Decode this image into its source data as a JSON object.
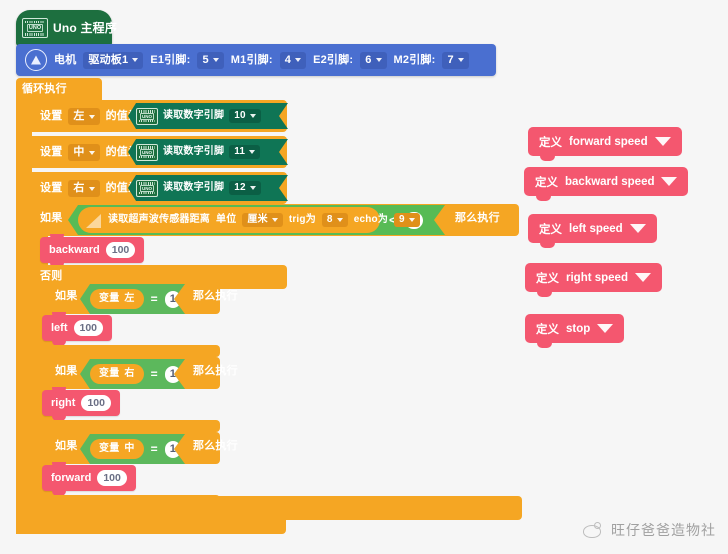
{
  "app": {
    "hat_label": "Uno 主程序",
    "uno_icon_text": "UNO"
  },
  "motor_block": {
    "title": "电机",
    "board_label": "驱动板1",
    "e1_label": "E1引脚:",
    "e1_value": "5",
    "m1_label": "M1引脚:",
    "m1_value": "4",
    "e2_label": "E2引脚:",
    "e2_value": "6",
    "m2_label": "M2引脚:",
    "m2_value": "7"
  },
  "loop": {
    "label": "循环执行"
  },
  "set_rows": [
    {
      "set": "设置",
      "var": "左",
      "of": "的值为",
      "read": "读取数字引脚",
      "pin": "10"
    },
    {
      "set": "设置",
      "var": "中",
      "of": "的值为",
      "read": "读取数字引脚",
      "pin": "11"
    },
    {
      "set": "设置",
      "var": "右",
      "of": "的值为",
      "read": "读取数字引脚",
      "pin": "12"
    }
  ],
  "outer_if": {
    "if_label": "如果",
    "then_label": "那么执行",
    "else_label": "否则",
    "sensor_text": "读取超声波传感器距离",
    "unit_label": "单位",
    "unit_value": "厘米",
    "trig_label": "trig为",
    "trig_value": "8",
    "echo_label": "echo为",
    "echo_value": "9",
    "operator": "<",
    "threshold": "6",
    "body_action": {
      "name": "backward",
      "value": "100"
    }
  },
  "inner_ifs": [
    {
      "if_label": "如果",
      "then_label": "那么执行",
      "var_label": "变量",
      "var_name": "左",
      "operator": "=",
      "value": "1",
      "action": {
        "name": "left",
        "value": "100"
      }
    },
    {
      "if_label": "如果",
      "then_label": "那么执行",
      "var_label": "变量",
      "var_name": "右",
      "operator": "=",
      "value": "1",
      "action": {
        "name": "right",
        "value": "100"
      }
    },
    {
      "if_label": "如果",
      "then_label": "那么执行",
      "var_label": "变量",
      "var_name": "中",
      "operator": "=",
      "value": "1",
      "action": {
        "name": "forward",
        "value": "100"
      }
    }
  ],
  "definitions": [
    {
      "prefix": "定义",
      "name": "forward speed"
    },
    {
      "prefix": "定义",
      "name": "backward speed"
    },
    {
      "prefix": "定义",
      "name": "left speed"
    },
    {
      "prefix": "定义",
      "name": "right speed"
    },
    {
      "prefix": "定义",
      "name": "stop"
    }
  ],
  "watermark": {
    "text": "旺仔爸爸造物社"
  },
  "colors": {
    "hat_green": "#1d6f3f",
    "motor_blue": "#4a6fd0",
    "control_orange": "#f5a623",
    "sensor_green": "#0f7555",
    "operator_green": "#5cb85c",
    "action_pink": "#f4576f",
    "canvas": "#f6f6f6"
  }
}
